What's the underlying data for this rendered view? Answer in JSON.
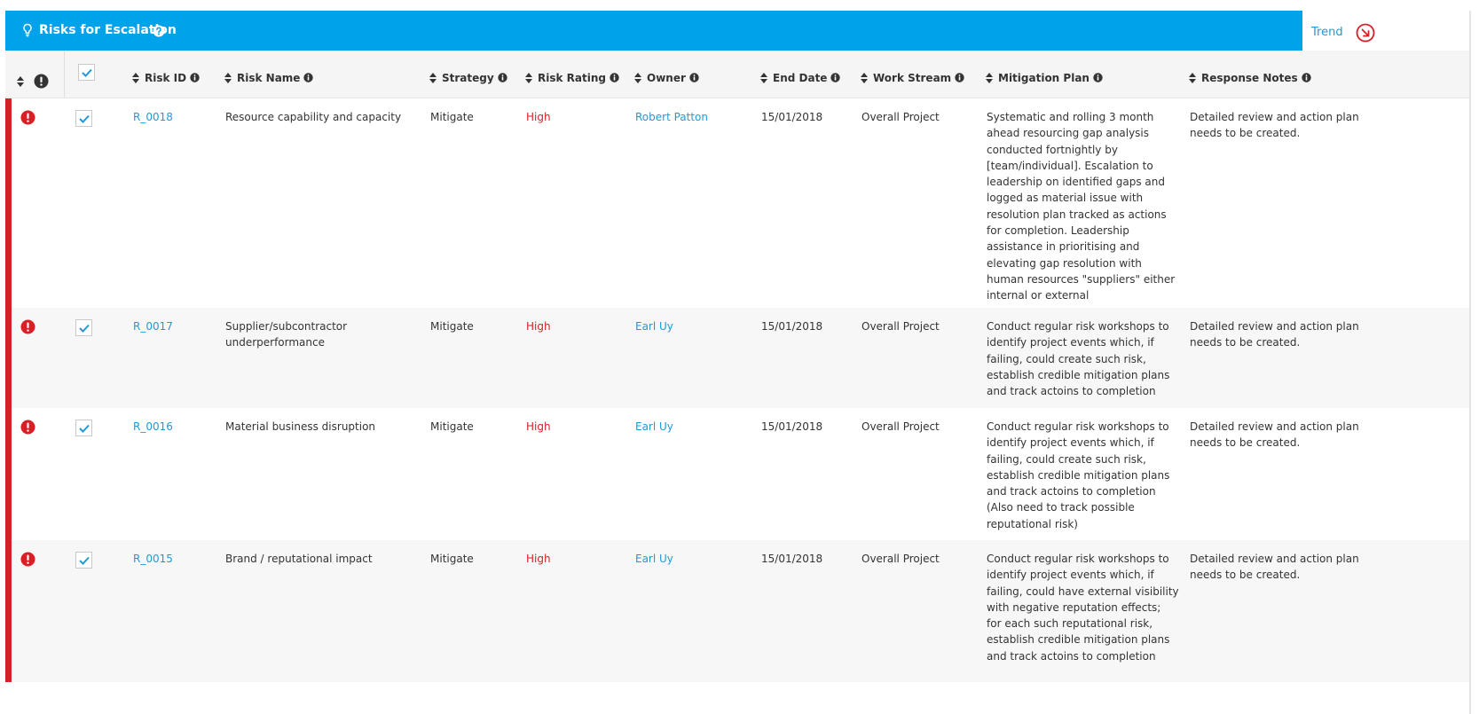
{
  "panel": {
    "title": "Risks for Escalation",
    "trend_label": "Trend"
  },
  "colors": {
    "header_bg": "#00a2ea",
    "link": "#1f9ad6",
    "high": "#d81f26",
    "row_bar": "#d81f26"
  },
  "columns": [
    {
      "key": "risk_id",
      "label": "Risk ID"
    },
    {
      "key": "risk_name",
      "label": "Risk Name"
    },
    {
      "key": "strategy",
      "label": "Strategy"
    },
    {
      "key": "rating",
      "label": "Risk Rating"
    },
    {
      "key": "owner",
      "label": "Owner"
    },
    {
      "key": "end_date",
      "label": "End Date"
    },
    {
      "key": "work_stream",
      "label": "Work Stream"
    },
    {
      "key": "mitigation",
      "label": "Mitigation Plan"
    },
    {
      "key": "notes",
      "label": "Response Notes"
    }
  ],
  "rows": [
    {
      "risk_id": "R_0018",
      "risk_name": [
        "Resource capability and capacity"
      ],
      "strategy": "Mitigate",
      "rating": "High",
      "owner": "Robert Patton",
      "end_date": "15/01/2018",
      "work_stream": "Overall Project",
      "mitigation": [
        "Systematic and rolling 3 month",
        "ahead resourcing gap analysis",
        "conducted fortnightly by",
        "[team/individual]. Escalation to",
        "leadership on identified gaps and",
        "logged as material issue with",
        "resolution plan tracked as actions",
        "for completion. Leadership",
        "assistance in prioritising and",
        "elevating gap resolution with",
        "human resources \"suppliers\" either",
        "internal or external"
      ],
      "notes": [
        "Detailed review and action plan",
        "needs to be created."
      ],
      "checked": true
    },
    {
      "risk_id": "R_0017",
      "risk_name": [
        "Supplier/subcontractor",
        "underperformance"
      ],
      "strategy": "Mitigate",
      "rating": "High",
      "owner": "Earl Uy",
      "end_date": "15/01/2018",
      "work_stream": "Overall Project",
      "mitigation": [
        "Conduct regular risk workshops to",
        "identify project events which, if",
        "failing, could create such risk,",
        "establish credible mitigation plans",
        "and track actoins to completion"
      ],
      "notes": [
        "Detailed review and action plan",
        "needs to be created."
      ],
      "checked": true
    },
    {
      "risk_id": "R_0016",
      "risk_name": [
        "Material business disruption"
      ],
      "strategy": "Mitigate",
      "rating": "High",
      "owner": "Earl Uy",
      "end_date": "15/01/2018",
      "work_stream": "Overall Project",
      "mitigation": [
        "Conduct regular risk workshops to",
        "identify project events which, if",
        "failing, could create such risk,",
        "establish credible mitigation plans",
        "and track actoins to completion",
        "(Also need to track possible",
        "reputational risk)"
      ],
      "notes": [
        "Detailed review and action plan",
        "needs to be created."
      ],
      "checked": true
    },
    {
      "risk_id": "R_0015",
      "risk_name": [
        "Brand / reputational impact"
      ],
      "strategy": "Mitigate",
      "rating": "High",
      "owner": "Earl Uy",
      "end_date": "15/01/2018",
      "work_stream": "Overall Project",
      "mitigation": [
        "Conduct regular risk workshops to",
        "identify project events which, if",
        "failing, could have external visibility",
        "with negative reputation effects;",
        "for each such reputational risk,",
        "establish credible mitigation plans",
        "and track actoins to completion"
      ],
      "notes": [
        "Detailed review and action plan",
        "needs to be created."
      ],
      "checked": true
    }
  ],
  "icons": {
    "title": "lightbulb-icon",
    "help": "question-circle-icon",
    "trend": "arrow-down-right-circle-icon",
    "sort": "sort-icon",
    "info": "info-circle-icon",
    "flag": "exclamation-circle-icon",
    "check": "check-icon"
  }
}
